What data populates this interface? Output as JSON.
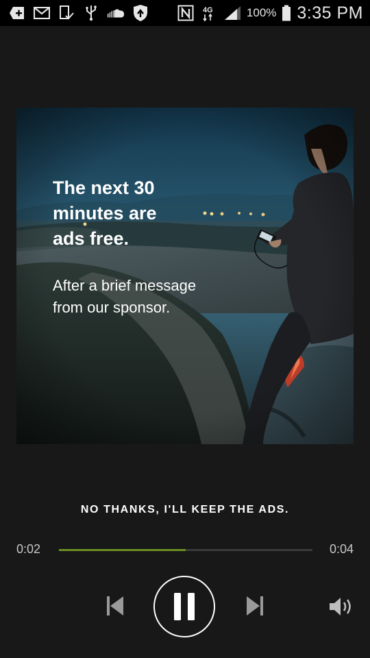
{
  "status_bar": {
    "icons": [
      "add-box-icon",
      "mail-icon",
      "device-check-icon",
      "usb-icon",
      "soundcloud-icon",
      "shield-icon",
      "nfc-icon",
      "4g-icon",
      "signal-icon",
      "battery-icon"
    ],
    "battery": "100%",
    "time": "3:35 PM",
    "network": "4G"
  },
  "ad": {
    "headline": "The next 30\nminutes are\nads free.",
    "subtext": "After a brief message\nfrom our sponsor."
  },
  "actions": {
    "decline": "NO THANKS, I'LL KEEP THE ADS."
  },
  "player": {
    "elapsed": "0:02",
    "total": "0:04",
    "progress_fraction": 0.5
  },
  "colors": {
    "background": "#181818",
    "progress_fill": "#6c8f22",
    "progress_track": "#3a3a3a",
    "text": "#ffffff"
  }
}
